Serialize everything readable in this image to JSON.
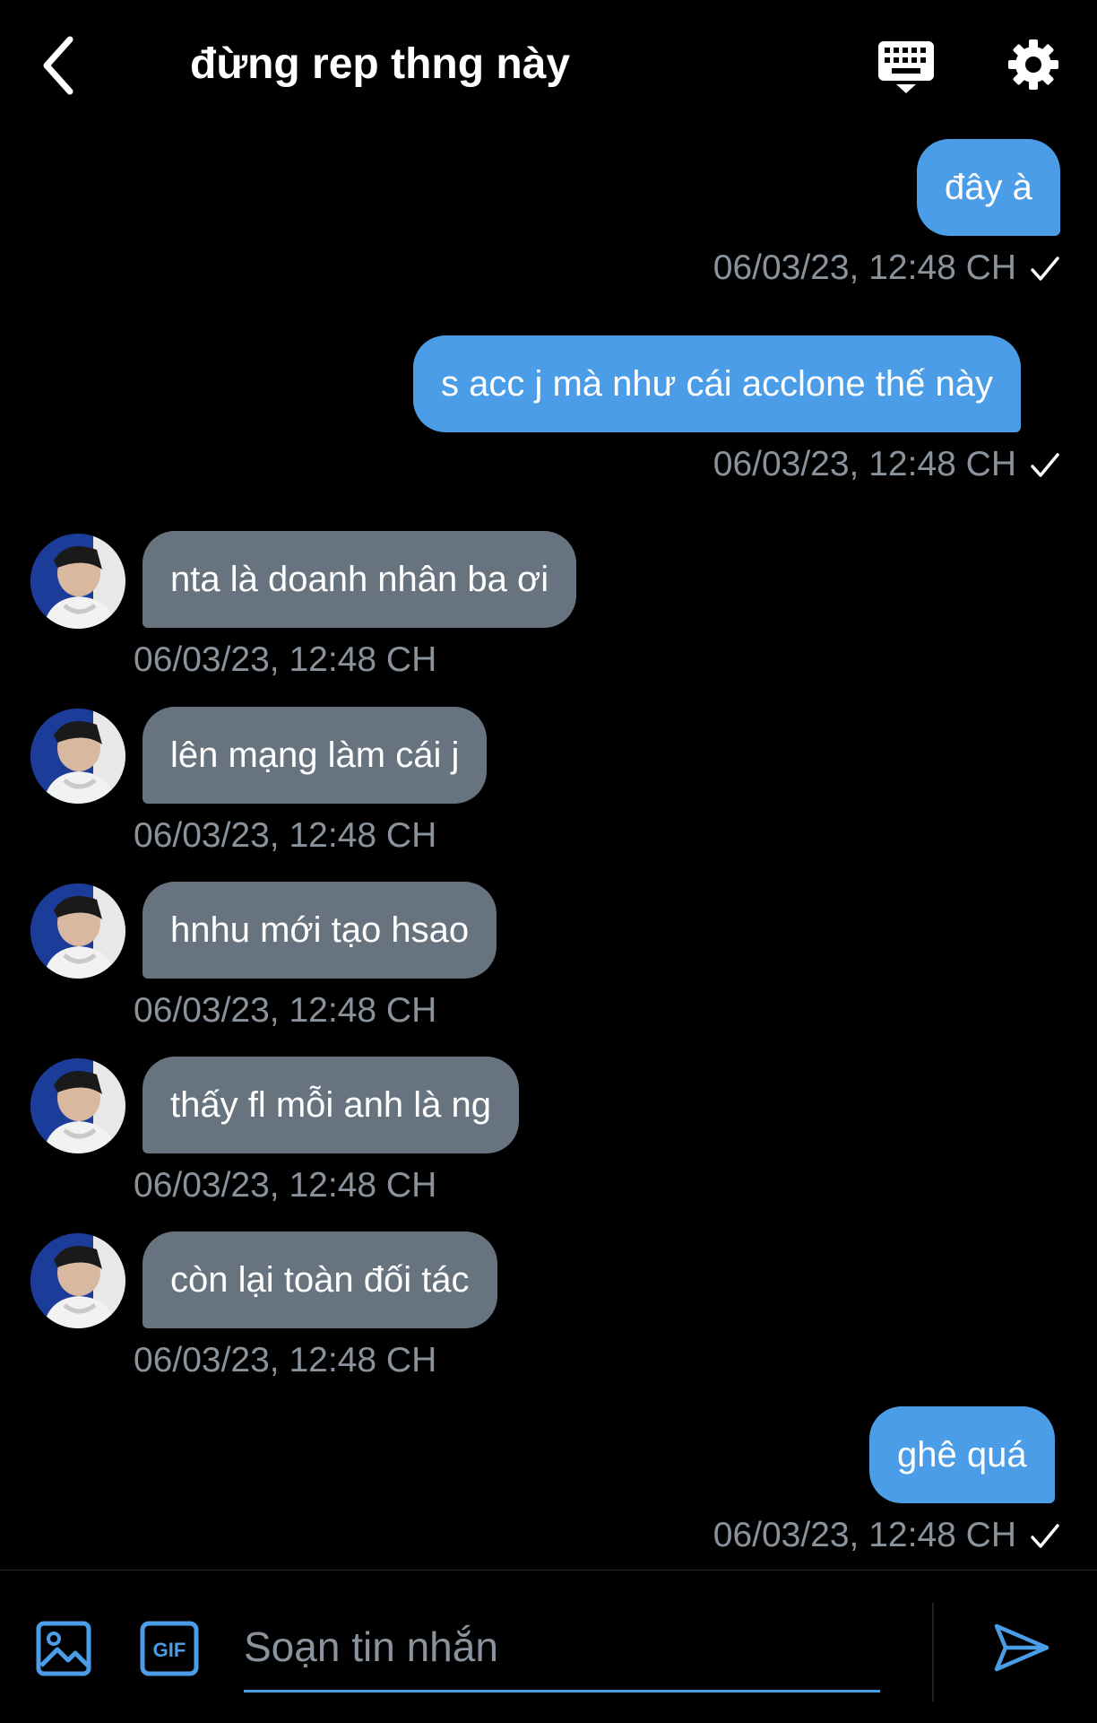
{
  "header": {
    "title": "đừng rep thng này",
    "back_icon": "chevron-left-icon",
    "keyboard_icon": "keyboard-icon",
    "settings_icon": "gear-icon"
  },
  "colors": {
    "background": "#000000",
    "outgoing_bubble": "#4a9de6",
    "incoming_bubble": "#67737f",
    "timestamp": "#8a939b",
    "accent": "#4a9de6"
  },
  "messages": [
    {
      "direction": "outgoing",
      "text": "đây à",
      "time": "06/03/23, 12:48 CH",
      "read_icon": "check-icon"
    },
    {
      "direction": "outgoing",
      "text": "s acc j mà như cái acclone thế này",
      "time": "06/03/23, 12:48 CH",
      "read_icon": "check-icon"
    },
    {
      "direction": "incoming",
      "text": "nta là doanh nhân ba ơi",
      "time": "06/03/23, 12:48 CH"
    },
    {
      "direction": "incoming",
      "text": "lên mạng làm cái j",
      "time": "06/03/23, 12:48 CH"
    },
    {
      "direction": "incoming",
      "text": "hnhu mới tạo hsao",
      "time": "06/03/23, 12:48 CH"
    },
    {
      "direction": "incoming",
      "text": "thấy fl mỗi anh là ng",
      "time": "06/03/23, 12:48 CH"
    },
    {
      "direction": "incoming",
      "text": "còn lại toàn đối tác",
      "time": "06/03/23, 12:48 CH"
    },
    {
      "direction": "outgoing",
      "text": "ghê quá",
      "time": "06/03/23, 12:48 CH",
      "read_icon": "check-icon"
    }
  ],
  "composer": {
    "placeholder": "Soạn tin nhắn",
    "image_icon": "image-icon",
    "gif_label": "GIF",
    "send_icon": "send-icon"
  }
}
